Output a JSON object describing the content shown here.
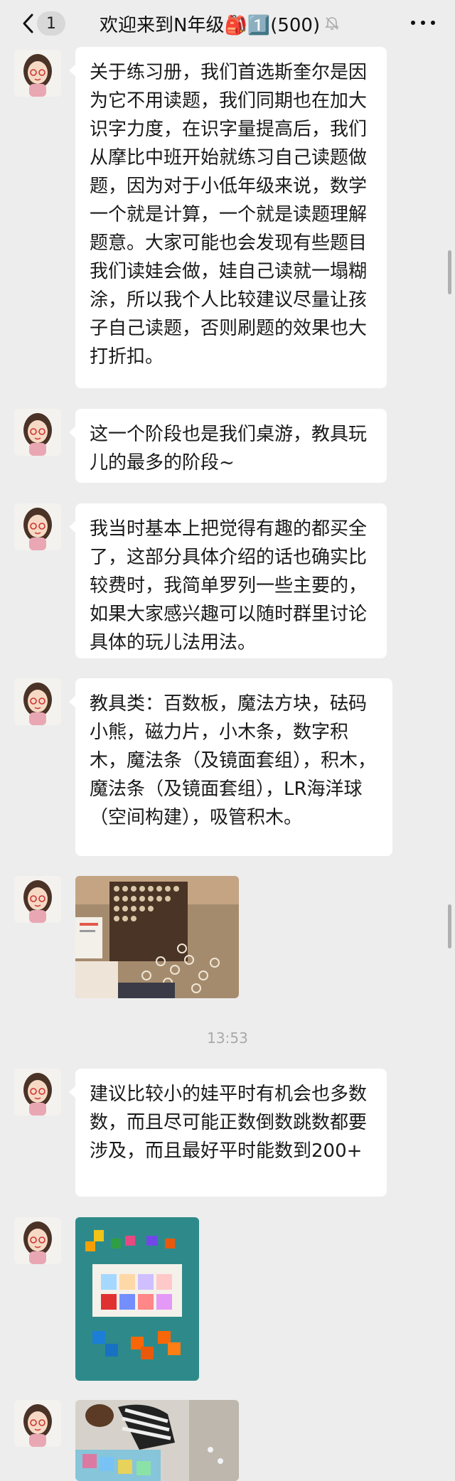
{
  "header": {
    "back_label": "<",
    "unread_count": "1",
    "title": "欢迎来到N年级🎒1️⃣(500)"
  },
  "messages": [
    {
      "text": "关于练习册，我们首选斯奎尔是因为它不用读题，我们同期也在加大识字力度，在识字量提高后，我们从摩比中班开始就练习自己读题做题，因为对于小低年级来说，数学一个就是计算，一个就是读题理解题意。大家可能也会发现有些题目我们读娃会做，娃自己读就一塌糊涂，所以我个人比较建议尽量让孩子自己读题，否则刷题的效果也大打折扣。"
    },
    {
      "text": "这一个阶段也是我们桌游，教具玩儿的最多的阶段~"
    },
    {
      "text": "我当时基本上把觉得有趣的都买全了，这部分具体介绍的话也确实比较费时，我简单罗列一些主要的，如果大家感兴趣可以随时群里讨论具体的玩儿法用法。"
    },
    {
      "text": "教具类：百数板，魔法方块，砝码小熊，磁力片，小木条，数字积木，魔法条（及镜面套组），积木，魔法条（及镜面套组），LR海洋球（空间构建），吸管积木。"
    },
    {
      "text": "建议比较小的娃平时有机会也多数数，而且尽可能正数倒数跳数都要涉及，而且最好平时能数到200+"
    }
  ],
  "timestamp": "13:53",
  "colors": {
    "background": "#ededed",
    "bubble": "#ffffff",
    "timestamp": "#a9a9a9"
  },
  "icons": [
    "back-arrow-icon",
    "mute-bell-icon",
    "more-icon"
  ]
}
